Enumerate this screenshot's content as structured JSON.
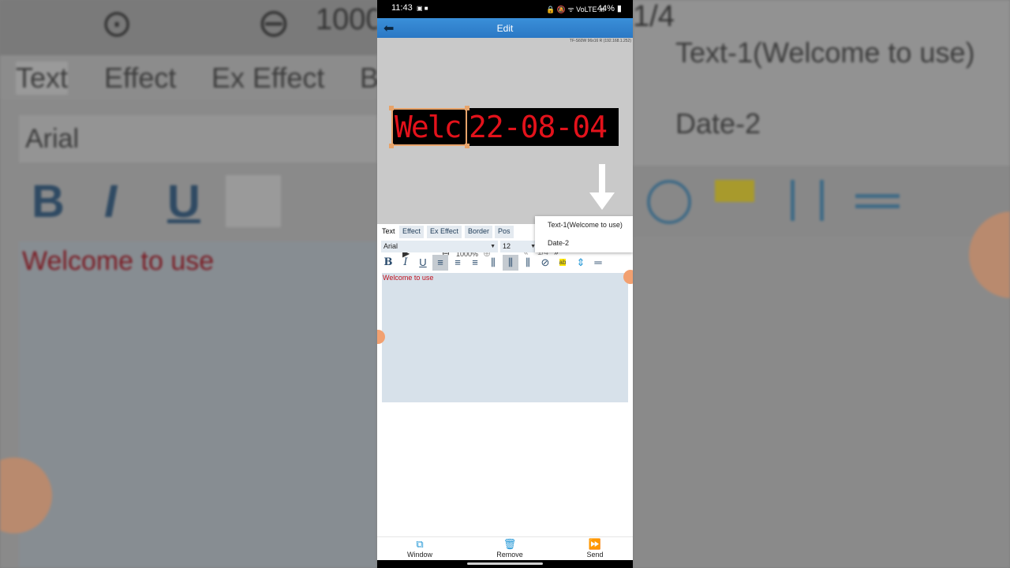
{
  "status_bar": {
    "time": "11:43",
    "left_icons": "▣ ■",
    "right_icons": "🔒 🔕 ᯤ VoLTE .ıl",
    "battery": "44% ▮"
  },
  "title_bar": {
    "back_icon": "back-arrow-icon",
    "title": "Edit"
  },
  "canvas": {
    "device_label": "TF-S60W 96x16 R (192.168.1.252)",
    "led_text_1": "Welc",
    "led_text_2": "22-08-04",
    "zoom": "1000%",
    "page": "1/4",
    "nav_prev": "«",
    "nav_next": "»",
    "play_glyph": "▶",
    "zoom_out_glyph": "⊖",
    "zoom_in_glyph": "⊕"
  },
  "tabs": [
    "Text",
    "Effect",
    "Ex Effect",
    "Border",
    "Pos"
  ],
  "font": {
    "family": "Arial",
    "size": "12"
  },
  "format_buttons": {
    "bold": "B",
    "italic": "I",
    "underline": "U",
    "align_left": "≡",
    "align_center": "≡",
    "align_right": "≡",
    "spacing_1": "⫼",
    "spacing_2": "⫼",
    "spacing_3": "⫼",
    "rotate": "⊘",
    "highlight": "ab",
    "line_spacing": "⇕",
    "divider": "═"
  },
  "editor": {
    "text": "Welcome to use"
  },
  "popup_menu": {
    "items": [
      "Text-1(Welcome to use)",
      "Date-2"
    ]
  },
  "bottom_bar": {
    "window": "Window",
    "remove": "Remove",
    "send": "Send",
    "window_glyph": "⧉",
    "remove_glyph": "🗑",
    "send_glyph": "⏩"
  },
  "background_zoom": {
    "tabs": [
      "Text",
      "Effect",
      "Ex Effect",
      "B"
    ],
    "font": "Arial",
    "editor_text": "Welcome to use",
    "zoom_partial": "1000",
    "page_partial": "1/4",
    "menu_items": [
      "Text-1(Welcome to use)",
      "Date-2"
    ],
    "fmt": [
      "B",
      "I",
      "U"
    ]
  }
}
